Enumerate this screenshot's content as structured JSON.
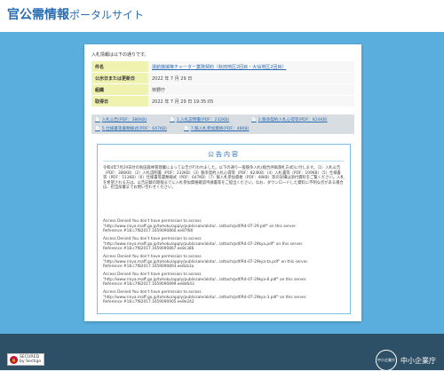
{
  "header": {
    "title_main": "官公需情報",
    "title_sub": "ポータルサイト"
  },
  "card": {
    "notice": "入札情報は以下の通りです。",
    "meta": [
      {
        "key": "件名",
        "value": "運航機械等チャーター業務契約（秋田地区2回目・大仙地区2回目）",
        "link": true
      },
      {
        "key": "公示日または更新日",
        "value": "2022 年 7 月 29 日"
      },
      {
        "key": "組織",
        "value": "林野庁"
      },
      {
        "key": "取得日",
        "value": "2022 年 7 月 29 日 19:35:05"
      }
    ],
    "attachments": [
      "入札公告(PDF：386KB)",
      "1.入札説明書(PDF：232KB)",
      "2.競争契約入札心得等(PDF：824KB)",
      "5.仕様書等書類様式(PDF：647KB)",
      "7.競入札参加資格(PDF：48KB)"
    ],
    "box_title": "公告内容",
    "body": "令和4年7月29日付の秋田森林管理署によって公告が行われました。以下の通り一般競争入札(総合評価落札方式)に付します。（1）入札公告（PDF：386KB）（2）入札説明書（PDF：232KB）（3）競争契約入札心得等（PDF：824KB）（4）入札書等（PDF：109KB）（5）仕様書等（PDF：513KB）（6）仕様書等書類様式（PDF：647KB）（7）競入札参加資格（PDF：48KB）等の詳細は添付資料をご覧ください。入札を希望される方は、公告記載の期限までに入札参加資格確認申請書等をご提出ください。なお、ダウンロードした資料に不明な点がある場合は、担当部署までお問い合わせください。",
    "errors": [
      {
        "line1": "Access Denied You don't have permission to access",
        "line2": "\"http://www.rinya.maff.go.jp/tohoku/apply/publicsale/akita/.../attach/pdf/R4-07-29.pdf\" on this server.",
        "ref": "Reference #18.c7f82017.1659090860.ee87f80"
      },
      {
        "line1": "Access Denied You don't have permission to access",
        "line2": "\"http://www.rinya.maff.go.jp/tohoku/apply/publicsale/akita/.../attach/pdf/R4-07-29kya.pdf\" on this server.",
        "ref": "Reference #18.c7f82017.1659090867.ee8c386"
      },
      {
        "line1": "Access Denied You don't have permission to access",
        "line2": "\"http://www.rinya.maff.go.jp/tohoku/apply/publicsale/akita/.../attach/pdf/R4-07-29kya-ta.pdf\" on this server.",
        "ref": "Reference #18.c7f82017.1659090893.ee8cb3a"
      },
      {
        "line1": "Access Denied You don't have permission to access",
        "line2": "\"http://www.rinya.maff.go.jp/tohoku/apply/publicsale/akita/.../attach/pdf/R4-07-29kya-6.pdf\" on this server.",
        "ref": "Reference #18.c7f82017.1659090899.ee8d643"
      },
      {
        "line1": "Access Denied You don't have permission to access",
        "line2": "\"http://www.rinya.maff.go.jp/tohoku/apply/publicsale/akita/.../attach/pdf/R4-07-29kya-3.pdf\" on this server.",
        "ref": "Reference #18.c7f82017.1659090905.ee8e242"
      }
    ]
  },
  "footer": {
    "seal_brand": "SECURED",
    "seal_by": "by Sectigo",
    "agency_mark": "中小企業庁",
    "agency_name": "中小企業庁"
  },
  "colors": {
    "header_accent": "#2a6db3",
    "band": "#5aaede",
    "footer": "#2e5066"
  }
}
